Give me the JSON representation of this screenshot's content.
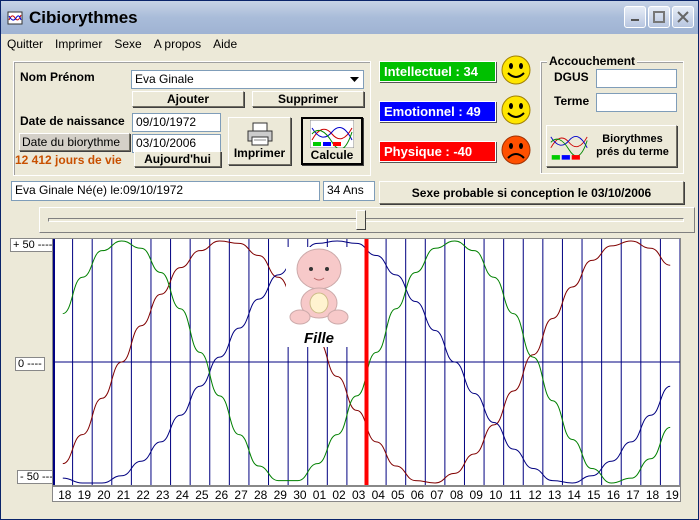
{
  "window": {
    "title": "Cibiorythmes"
  },
  "menu": [
    "Quitter",
    "Imprimer",
    "Sexe",
    "A propos",
    "Aide"
  ],
  "form": {
    "name_label": "Nom Prénom",
    "name_value": "Eva Ginale",
    "add_label": "Ajouter",
    "delete_label": "Supprimer",
    "birth_label": "Date de naissance",
    "birth_value": "09/10/1972",
    "bio_date_label": "Date du biorythme",
    "bio_date_value": "03/10/2006",
    "today_label": "Aujourd'hui",
    "days_text": "12 412 jours de vie",
    "print_label": "Imprimer",
    "calc_label": "Calcule"
  },
  "statuses": [
    {
      "label": "Intellectuel : 34",
      "color": "#00c000",
      "mood": "happy"
    },
    {
      "label": "Emotionnel : 49",
      "color": "#0000ff",
      "mood": "happy"
    },
    {
      "label": "Physique :   -40",
      "color": "#ff0000",
      "mood": "sad"
    }
  ],
  "birth": {
    "group_label": "Accouchement",
    "dgus_label": "DGUS",
    "dgus_value": "",
    "term_label": "Terme",
    "term_value": "",
    "bio_term_label_1": "Biorythmes",
    "bio_term_label_2": "prés du terme"
  },
  "info": {
    "summary": "Eva Ginale Né(e) le:09/10/1972",
    "age": "34 Ans",
    "sex_probable": "Sexe probable si conception le 03/10/2006"
  },
  "slider": {
    "value": 0.5
  },
  "baby_label": "Fille",
  "colors": {
    "intellectual": "#008000",
    "emotional": "#000080",
    "physical": "#800000",
    "today": "#ff0000",
    "grid": "#000080"
  },
  "chart_data": {
    "type": "line",
    "x": [
      "18",
      "19",
      "20",
      "21",
      "22",
      "23",
      "24",
      "25",
      "26",
      "27",
      "28",
      "29",
      "30",
      "01",
      "02",
      "03",
      "04",
      "05",
      "06",
      "07",
      "08",
      "09",
      "10",
      "11",
      "12",
      "13",
      "14",
      "15",
      "16",
      "17",
      "18",
      "19"
    ],
    "ylim": [
      -50,
      50
    ],
    "ytick_labels": [
      "+ 50 ----",
      "0 ----",
      "- 50 ----"
    ],
    "today_index": 15,
    "series": [
      {
        "values": [
          -42,
          -30,
          -15,
          0,
          15,
          28,
          39,
          46,
          50,
          49,
          44,
          35,
          23,
          9,
          -6,
          -20,
          -33,
          -43,
          -49,
          -50,
          -46,
          -38,
          -26,
          -12,
          3,
          18,
          31,
          42,
          48,
          50,
          47,
          40
        ]
      },
      {
        "values": [
          -48,
          -50,
          -50,
          -47,
          -41,
          -33,
          -22,
          -10,
          2,
          14,
          26,
          36,
          44,
          49,
          50,
          49,
          44,
          36,
          25,
          13,
          0,
          -13,
          -25,
          -36,
          -44,
          -49,
          -50,
          -47,
          -41,
          -33,
          -22,
          -10
        ]
      },
      {
        "values": [
          20,
          35,
          46,
          50,
          47,
          37,
          22,
          4,
          -14,
          -30,
          -43,
          -49,
          -49,
          -42,
          -30,
          -14,
          4,
          22,
          37,
          47,
          50,
          46,
          35,
          20,
          2,
          -16,
          -32,
          -44,
          -50,
          -48,
          -40,
          -27
        ]
      }
    ]
  }
}
